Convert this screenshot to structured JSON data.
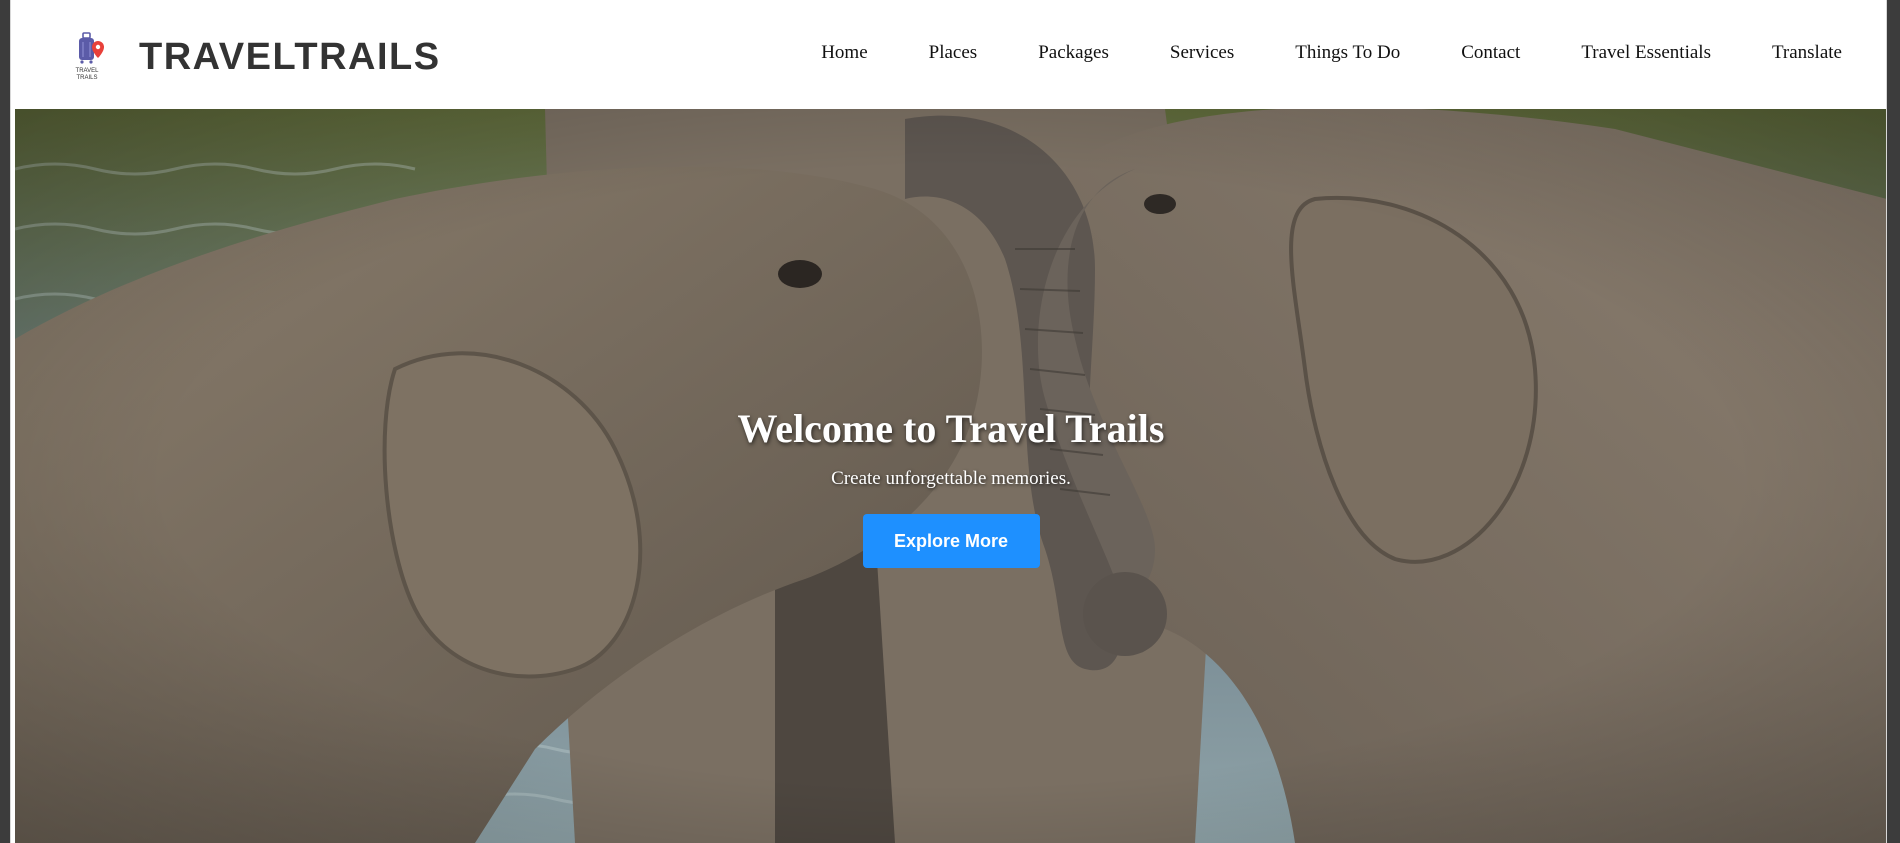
{
  "brand": {
    "name": "TRAVELTRAILS",
    "logo_text_line1": "TRAVEL",
    "logo_text_line2": "TRAILS"
  },
  "nav": {
    "items": [
      {
        "label": "Home"
      },
      {
        "label": "Places"
      },
      {
        "label": "Packages"
      },
      {
        "label": "Services"
      },
      {
        "label": "Things To Do"
      },
      {
        "label": "Contact"
      },
      {
        "label": "Travel Essentials"
      },
      {
        "label": "Translate"
      }
    ]
  },
  "hero": {
    "title": "Welcome to Travel Trails",
    "subtitle": "Create unforgettable memories.",
    "cta_label": "Explore More",
    "background_image": "elephants-playing-in-water"
  },
  "colors": {
    "accent": "#1e90ff",
    "brand_text": "#333333",
    "logo_purple": "#5b5ba8",
    "logo_red": "#e8403a"
  }
}
